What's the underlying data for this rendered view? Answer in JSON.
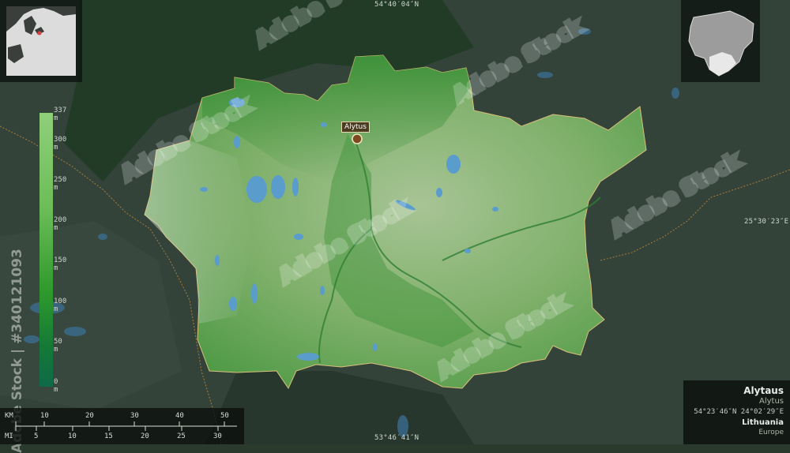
{
  "coords": {
    "top": "54°40′04″N",
    "bottom": "53°46′41″N",
    "right": "25°30′23″E"
  },
  "city": {
    "label": "Alytus"
  },
  "legend": {
    "ticks": [
      "337 m",
      "300 m",
      "250 m",
      "200 m",
      "150 m",
      "100 m",
      "50 m",
      "0 m"
    ],
    "ticks_note": "values of hidden ticks partially covered by watermark",
    "colors": {
      "high": "#8fcf7a",
      "mid": "#2f9a2c",
      "low": "#0e6a48"
    }
  },
  "scale": {
    "km_unit": "KM",
    "km_ticks": [
      "10",
      "20",
      "30",
      "40",
      "50"
    ],
    "mi_unit": "MI",
    "mi_ticks": [
      "5",
      "10",
      "15",
      "20",
      "25",
      "30"
    ]
  },
  "info": {
    "name": "Alytaus",
    "subname": "Alytus",
    "coords": "54°23′46″N 24°02′29″E",
    "country": "Lithuania",
    "continent": "Europe"
  },
  "watermark": {
    "stock_id": "Adobe Stock | #340121093",
    "logo_text": "Adobe Stock"
  },
  "colors": {
    "terrain_light": "#8db87a",
    "terrain_dark": "#3f8f3b",
    "water": "#4f8fc0",
    "outside": "#2f3d31"
  }
}
